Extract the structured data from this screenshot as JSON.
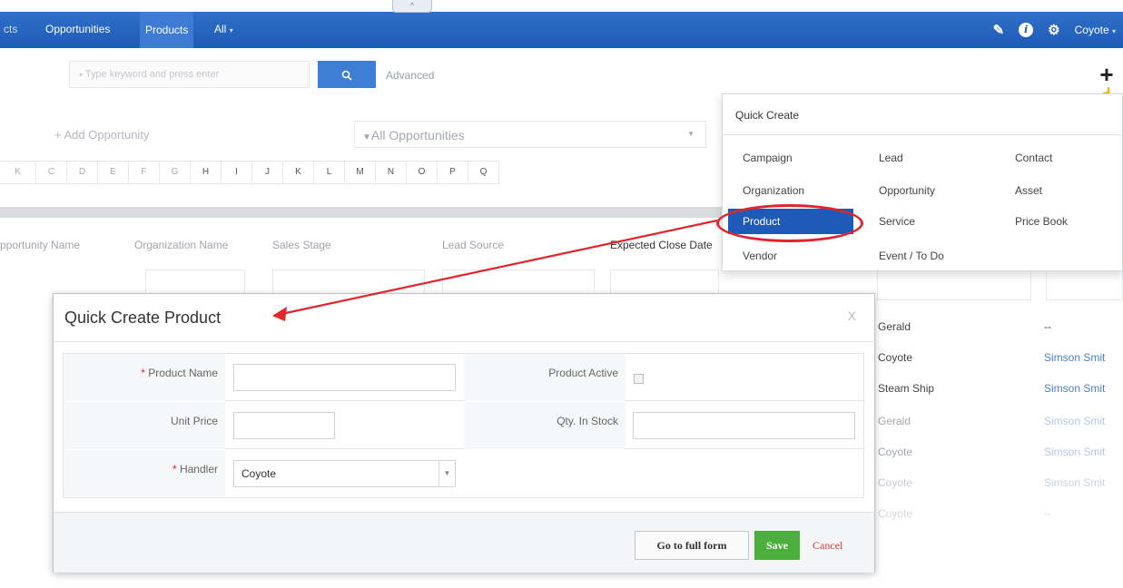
{
  "topnav": {
    "item_partial": "cts",
    "opportunities": "Opportunities",
    "products": "Products",
    "all": "All",
    "collapse": "^",
    "user": "Coyote"
  },
  "toolbar": {
    "search_placeholder": "Type keyword and press enter",
    "advanced": "Advanced",
    "add_opportunity": "+ Add Opportunity",
    "filter": "All Opportunities"
  },
  "alphabet": [
    "K",
    "C",
    "D",
    "E",
    "F",
    "G",
    "H",
    "I",
    "J",
    "K",
    "L",
    "M",
    "N",
    "O",
    "P",
    "Q"
  ],
  "columns": {
    "opportunity_name": "pportunity Name",
    "organization_name": "Organization Name",
    "sales_stage": "Sales Stage",
    "lead_source": "Lead Source",
    "expected_close_date": "Expected Close Date"
  },
  "rows": [
    {
      "owner": "Gerald",
      "contact": "--"
    },
    {
      "owner": "Coyote",
      "contact": "Simson Smit"
    },
    {
      "owner": "Steam Ship",
      "contact": "Simson Smit"
    },
    {
      "owner": "Gerald",
      "contact": "Simson Smit"
    },
    {
      "owner": "Coyote",
      "contact": "Simson Smit"
    },
    {
      "owner": "Coyote",
      "contact": "Simson Smit"
    },
    {
      "owner": "Coyote",
      "contact": "--"
    }
  ],
  "quick_create": {
    "title": "Quick Create",
    "items": {
      "campaign": "Campaign",
      "lead": "Lead",
      "contact": "Contact",
      "organization": "Organization",
      "opportunity": "Opportunity",
      "asset": "Asset",
      "product": "Product",
      "service": "Service",
      "price_book": "Price Book",
      "vendor": "Vendor",
      "event_todo": "Event / To Do"
    }
  },
  "modal": {
    "title": "Quick Create Product",
    "close": "X",
    "product_name_label": "Product Name",
    "product_active_label": "Product Active",
    "unit_price_label": "Unit Price",
    "qty_in_stock_label": "Qty. In Stock",
    "handler_label": "Handler",
    "required_marker": "*",
    "handler_value": "Coyote",
    "product_name_value": "",
    "unit_price_value": "",
    "qty_value": "",
    "go_full_form": "Go to full form",
    "save": "Save",
    "cancel": "Cancel"
  }
}
